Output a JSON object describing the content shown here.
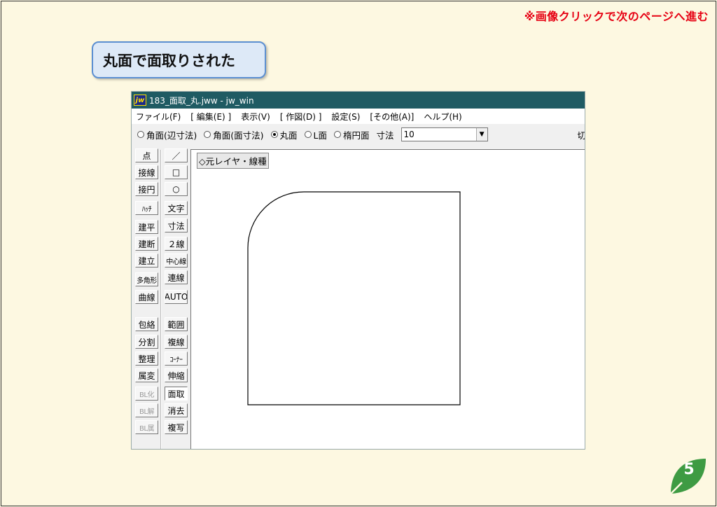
{
  "slide": {
    "next_hint": "※画像クリックで次のページへ進む",
    "callout": "丸面で面取りされた",
    "page_number": "5",
    "colors": {
      "hint": "#e60012",
      "callout_border": "#5b8fd1",
      "leaf": "#3e9b43"
    }
  },
  "window": {
    "title": "183_面取_丸.jww - jw_win",
    "app_icon": "jw",
    "menu": [
      "ファイル(F)",
      "[ 編集(E) ]",
      "表示(V)",
      "[ 作図(D) ]",
      "設定(S)",
      "[その他(A)]",
      "ヘルプ(H)"
    ],
    "options": [
      {
        "label": "角面(辺寸法)",
        "selected": false
      },
      {
        "label": "角面(面寸法)",
        "selected": true
      },
      {
        "label": "丸面",
        "selected": false
      },
      {
        "label": "L面",
        "selected": false
      },
      {
        "label": "楕円面",
        "selected": false
      }
    ],
    "dimension_label": "寸法",
    "dimension_value": "10",
    "cut_label": "切",
    "layer_label": "◇元レイヤ・線種",
    "tools_left": [
      {
        "label": "点",
        "disabled": false
      },
      {
        "label": "接線",
        "disabled": false
      },
      {
        "label": "接円",
        "disabled": false
      },
      {
        "label": "ﾊｯﾁ",
        "disabled": false
      },
      {
        "label": "建平",
        "disabled": false
      },
      {
        "label": "建断",
        "disabled": false
      },
      {
        "label": "建立",
        "disabled": false
      },
      {
        "label": "多角形",
        "disabled": false
      },
      {
        "label": "曲線",
        "disabled": false
      },
      {
        "label": "包絡",
        "disabled": false
      },
      {
        "label": "分割",
        "disabled": false
      },
      {
        "label": "整理",
        "disabled": false
      },
      {
        "label": "属変",
        "disabled": false
      },
      {
        "label": "BL化",
        "disabled": true
      },
      {
        "label": "BL解",
        "disabled": true
      },
      {
        "label": "BL属",
        "disabled": true
      }
    ],
    "tools_right": [
      {
        "label": "／",
        "icon": "line-icon"
      },
      {
        "label": "□",
        "icon": "rectangle-icon"
      },
      {
        "label": "○",
        "icon": "circle-icon"
      },
      {
        "label": "文字"
      },
      {
        "label": "寸法"
      },
      {
        "label": "２線"
      },
      {
        "label": "中心線"
      },
      {
        "label": "連線"
      },
      {
        "label": "AUTO"
      },
      {
        "label": "範囲"
      },
      {
        "label": "複線"
      },
      {
        "label": "ｺｰﾅｰ"
      },
      {
        "label": "伸縮"
      },
      {
        "label": "面取",
        "active": true
      },
      {
        "label": "消去"
      },
      {
        "label": "複写"
      }
    ]
  }
}
